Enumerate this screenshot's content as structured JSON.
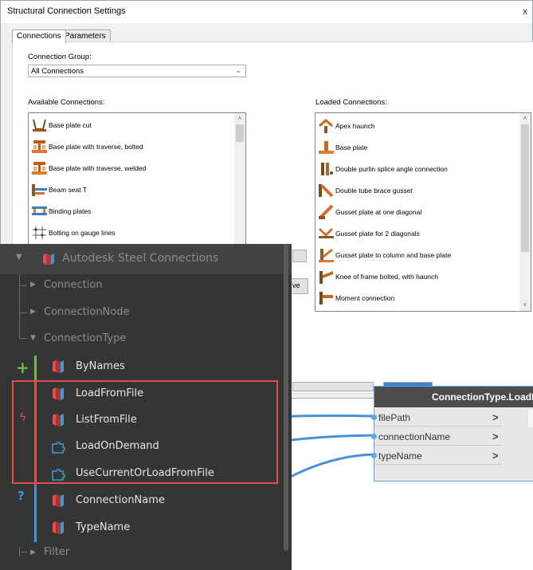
{
  "dialog": {
    "title": "Structural Connection Settings",
    "close_glyph": "x",
    "tabs": [
      {
        "label": "Connections",
        "active": true
      },
      {
        "label": "Parameters",
        "active": false
      }
    ],
    "connection_group": {
      "label": "Connection Group:",
      "value": "All Connections"
    },
    "available": {
      "label": "Available Connections:",
      "items": [
        {
          "label": "Base plate cut",
          "icon": "base-plate-cut-icon"
        },
        {
          "label": "Base plate with traverse, bolted",
          "icon": "base-plate-traverse-bolted-icon"
        },
        {
          "label": "Base plate with traverse, welded",
          "icon": "base-plate-traverse-welded-icon"
        },
        {
          "label": "Beam seat T",
          "icon": "beam-seat-t-icon"
        },
        {
          "label": "Binding plates",
          "icon": "binding-plates-icon"
        },
        {
          "label": "Bolting on gauge lines",
          "icon": "bolting-gauge-lines-icon"
        }
      ]
    },
    "loaded": {
      "label": "Loaded Connections:",
      "items": [
        {
          "label": "Apex haunch",
          "icon": "apex-haunch-icon"
        },
        {
          "label": "Base plate",
          "icon": "base-plate-icon"
        },
        {
          "label": "Double purlin splice angle connection",
          "icon": "double-purlin-splice-icon"
        },
        {
          "label": "Double tube brace gusset",
          "icon": "double-tube-brace-icon"
        },
        {
          "label": "Gusset plate at one diagonal",
          "icon": "gusset-one-diagonal-icon"
        },
        {
          "label": "Gusset plate for 2 diagonals",
          "icon": "gusset-two-diagonals-icon"
        },
        {
          "label": "Gusset plate to column and base plate",
          "icon": "gusset-column-base-icon"
        },
        {
          "label": "Knee of frame bolted, with haunch",
          "icon": "knee-frame-haunch-icon"
        },
        {
          "label": "Moment connection",
          "icon": "moment-connection-icon"
        }
      ]
    },
    "partial_button_text": "ve"
  },
  "library": {
    "root": {
      "label": "Autodesk Steel Connections",
      "icon": "package-icon"
    },
    "categories": [
      {
        "label": "Connection",
        "expanded": false
      },
      {
        "label": "ConnectionNode",
        "expanded": false
      },
      {
        "label": "ConnectionType",
        "expanded": true
      }
    ],
    "items": [
      {
        "label": "ByNames",
        "group_marker": "+",
        "icon": "ribbon-node-icon"
      },
      {
        "label": "LoadFromFile",
        "group_marker": "",
        "icon": "ribbon-node-icon"
      },
      {
        "label": "ListFromFile",
        "group_marker": "ϟ",
        "icon": "ribbon-node-icon"
      },
      {
        "label": "LoadOnDemand",
        "group_marker": "",
        "icon": "puzzle-icon"
      },
      {
        "label": "UseCurrentOrLoadFromFile",
        "group_marker": "",
        "icon": "puzzle-icon"
      },
      {
        "label": "ConnectionName",
        "group_marker": "?",
        "icon": "ribbon-node-icon"
      },
      {
        "label": "TypeName",
        "group_marker": "",
        "icon": "ribbon-node-icon"
      }
    ],
    "footer_category": {
      "label": "Filter",
      "expanded": false
    },
    "colors": {
      "create": "#6fba44",
      "action": "#e0504d",
      "query": "#3c9ad1",
      "highlight_box": "#e0504d"
    }
  },
  "node": {
    "title": "ConnectionType.LoadFro",
    "ports": [
      {
        "name": "filePath",
        "arrow": ">"
      },
      {
        "name": "connectionName",
        "arrow": ">"
      },
      {
        "name": "typeName",
        "arrow": ">"
      }
    ],
    "wire_color": "#4a90d9"
  }
}
